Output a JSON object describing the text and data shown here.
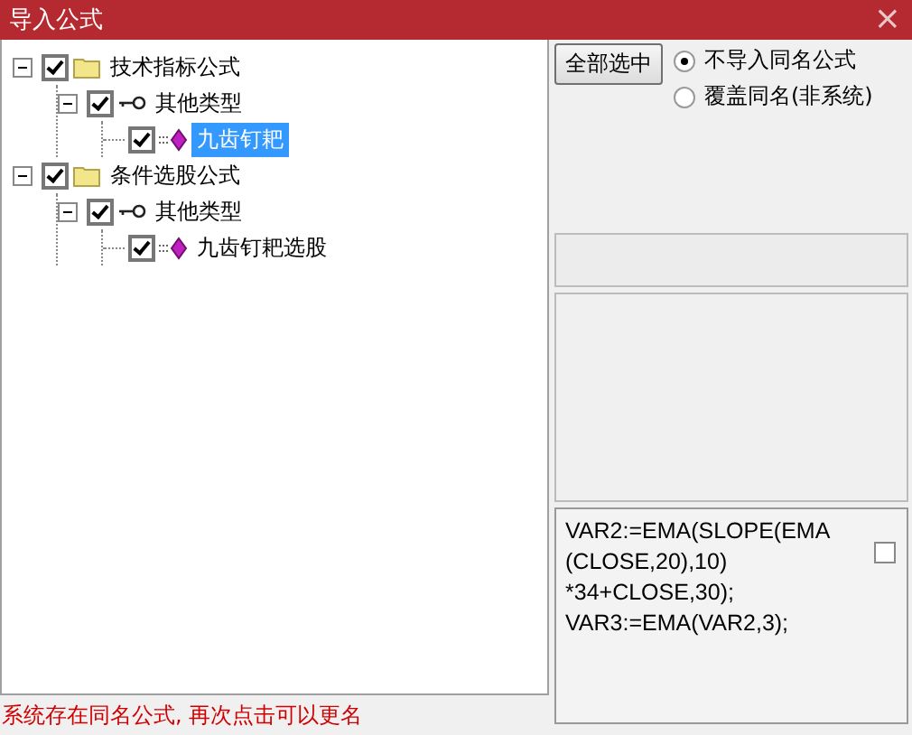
{
  "window": {
    "title": "导入公式",
    "close": "×"
  },
  "tree": [
    {
      "label": "技术指标公式",
      "kind": "folder",
      "checked": true,
      "expanded": true,
      "selected": false,
      "children": [
        {
          "label": "其他类型",
          "kind": "key",
          "checked": true,
          "expanded": true,
          "selected": false,
          "children": [
            {
              "label": "九齿钉耙",
              "kind": "diamond",
              "checked": true,
              "selected": true
            }
          ]
        }
      ]
    },
    {
      "label": "条件选股公式",
      "kind": "folder",
      "checked": true,
      "expanded": true,
      "selected": false,
      "children": [
        {
          "label": "其他类型",
          "kind": "key",
          "checked": true,
          "expanded": true,
          "selected": false,
          "children": [
            {
              "label": "九齿钉耙选股",
              "kind": "diamond",
              "checked": true,
              "selected": false
            }
          ]
        }
      ]
    }
  ],
  "select_all_button": "全部选中",
  "options": [
    {
      "label": "不导入同名公式",
      "selected": true
    },
    {
      "label": "覆盖同名(非系统)",
      "selected": false
    }
  ],
  "formula": {
    "lines": [
      "VAR2:=EMA(SLOPE(EMA",
      "(CLOSE,20),10)",
      "*34+CLOSE,30);",
      "VAR3:=EMA(VAR2,3);"
    ],
    "checked": false
  },
  "status": "系统存在同名公式, 再次点击可以更名"
}
